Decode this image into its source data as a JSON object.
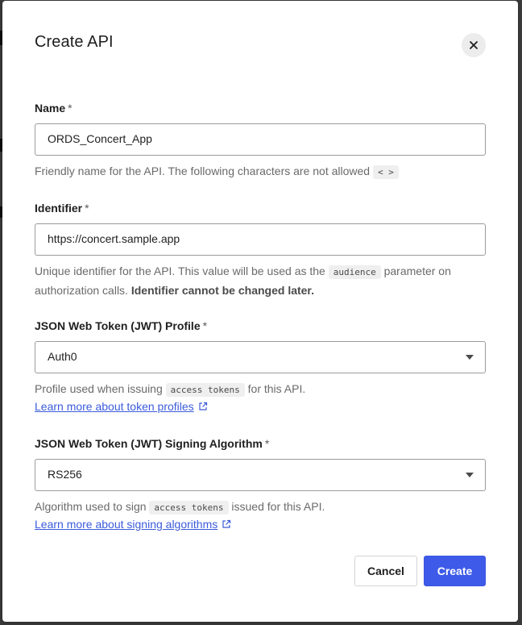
{
  "dialog": {
    "title": "Create API",
    "close_icon": "close-icon"
  },
  "fields": {
    "name": {
      "label": "Name",
      "required_mark": "*",
      "value": "ORDS_Concert_App",
      "help_text": "Friendly name for the API. The following characters are not allowed",
      "help_code": "< >"
    },
    "identifier": {
      "label": "Identifier",
      "required_mark": "*",
      "value": "https://concert.sample.app",
      "help_prefix": "Unique identifier for the API. This value will be used as the",
      "help_code": "audience",
      "help_suffix": "parameter on authorization calls.",
      "help_bold": "Identifier cannot be changed later."
    },
    "jwt_profile": {
      "label": "JSON Web Token (JWT) Profile",
      "required_mark": "*",
      "selected": "Auth0",
      "help_prefix": "Profile used when issuing",
      "help_code": "access tokens",
      "help_suffix": "for this API.",
      "link_text": "Learn more about token profiles"
    },
    "signing_algorithm": {
      "label": "JSON Web Token (JWT) Signing Algorithm",
      "required_mark": "*",
      "selected": "RS256",
      "help_prefix": "Algorithm used to sign",
      "help_code": "access tokens",
      "help_suffix": "issued for this API.",
      "link_text": "Learn more about signing algorithms"
    }
  },
  "actions": {
    "cancel_label": "Cancel",
    "create_label": "Create"
  },
  "colors": {
    "primary": "#3d5ae8",
    "link": "#3b5bdb"
  }
}
